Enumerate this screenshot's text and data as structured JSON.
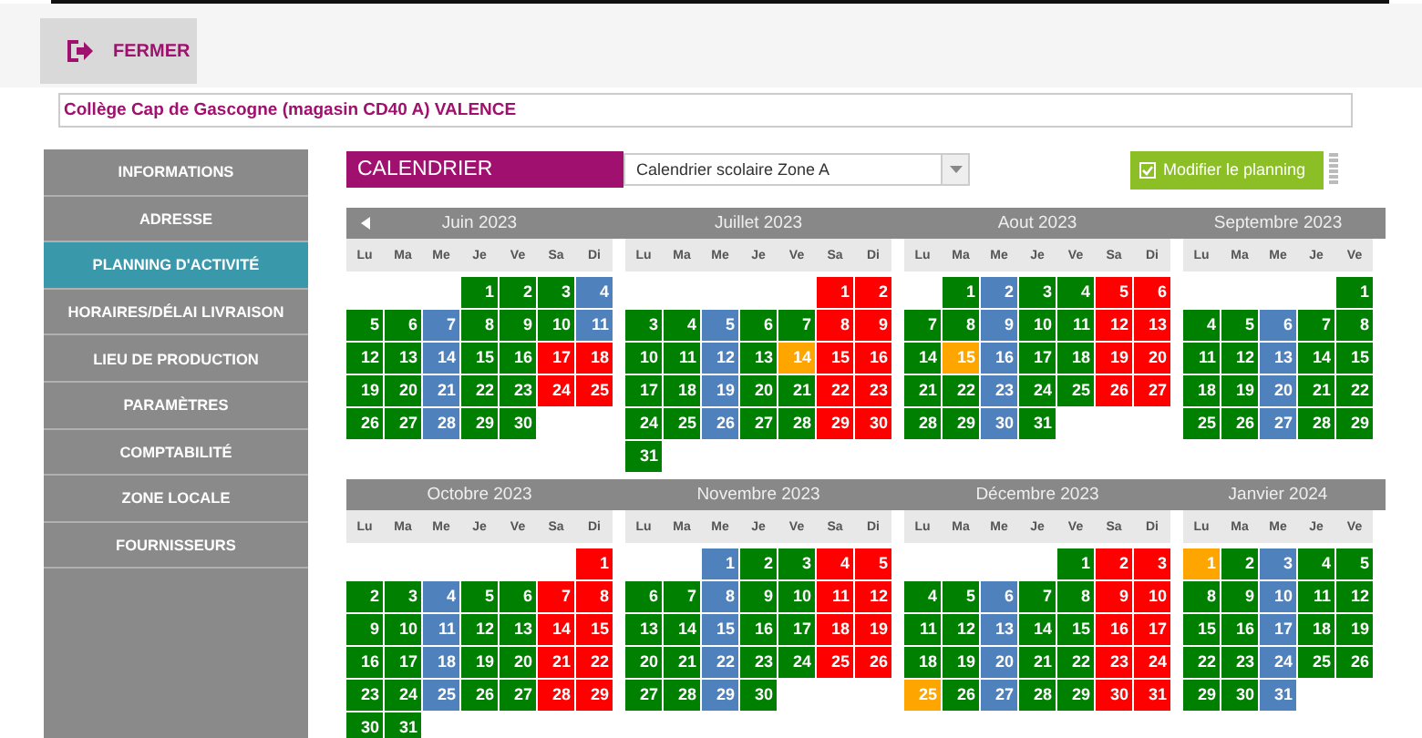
{
  "header": {
    "close_button": "FERMER"
  },
  "establishment": "Collège Cap de Gascogne (magasin CD40 A) VALENCE",
  "sidebar": {
    "items": [
      {
        "label": "INFORMATIONS",
        "selected": false
      },
      {
        "label": "ADRESSE",
        "selected": false
      },
      {
        "label": "PLANNING D'ACTIVITÉ",
        "selected": true
      },
      {
        "label": "HORAIRES/DÉLAI LIVRAISON",
        "selected": false
      },
      {
        "label": "LIEU DE PRODUCTION",
        "selected": false
      },
      {
        "label": "PARAMÈTRES",
        "selected": false
      },
      {
        "label": "COMPTABILITÉ",
        "selected": false
      },
      {
        "label": "ZONE LOCALE",
        "selected": false
      },
      {
        "label": "FOURNISSEURS",
        "selected": false
      }
    ]
  },
  "calendar": {
    "title": "CALENDRIER",
    "select_value": "Calendrier scolaire Zone A",
    "edit_button": "Modifier le planning",
    "rows": [
      {
        "months": [
          {
            "title": "Juin 2023",
            "weekdays": [
              "Lu",
              "Ma",
              "Me",
              "Je",
              "Ve",
              "Sa",
              "Di"
            ],
            "weeks": [
              [
                {
                  "day": "1",
                  "color": "#008000"
                },
                {
                  "day": "2",
                  "color": "#008000"
                },
                {
                  "day": "3",
                  "color": "#008000"
                },
                {
                  "day": "4",
                  "color": "#4f81bd"
                }
              ],
              [
                {
                  "day": "5",
                  "color": "#008000"
                },
                {
                  "day": "6",
                  "color": "#008000"
                },
                {
                  "day": "7",
                  "color": "#4f81bd"
                },
                {
                  "day": "8",
                  "color": "#008000"
                },
                {
                  "day": "9",
                  "color": "#008000"
                },
                {
                  "day": "10",
                  "color": "#008000"
                },
                {
                  "day": "11",
                  "color": "#4f81bd"
                }
              ],
              [
                {
                  "day": "12",
                  "color": "#008000"
                },
                {
                  "day": "13",
                  "color": "#008000"
                },
                {
                  "day": "14",
                  "color": "#4f81bd"
                },
                {
                  "day": "15",
                  "color": "#008000"
                },
                {
                  "day": "16",
                  "color": "#008000"
                },
                {
                  "day": "17",
                  "color": "#ff0000"
                },
                {
                  "day": "18",
                  "color": "#ff0000"
                }
              ],
              [
                {
                  "day": "19",
                  "color": "#008000"
                },
                {
                  "day": "20",
                  "color": "#008000"
                },
                {
                  "day": "21",
                  "color": "#4f81bd"
                },
                {
                  "day": "22",
                  "color": "#008000"
                },
                {
                  "day": "23",
                  "color": "#008000"
                },
                {
                  "day": "24",
                  "color": "#ff0000"
                },
                {
                  "day": "25",
                  "color": "#ff0000"
                }
              ],
              [
                {
                  "day": "26",
                  "color": "#008000"
                },
                {
                  "day": "27",
                  "color": "#008000"
                },
                {
                  "day": "28",
                  "color": "#4f81bd"
                },
                {
                  "day": "29",
                  "color": "#008000"
                },
                {
                  "day": "30",
                  "color": "#008000"
                }
              ]
            ]
          },
          {
            "title": "Juillet 2023",
            "weekdays": [
              "Lu",
              "Ma",
              "Me",
              "Je",
              "Ve",
              "Sa",
              "Di"
            ],
            "weeks": [
              [
                {
                  "day": "1",
                  "color": "#ff0000"
                },
                {
                  "day": "2",
                  "color": "#ff0000"
                }
              ],
              [
                {
                  "day": "3",
                  "color": "#008000"
                },
                {
                  "day": "4",
                  "color": "#008000"
                },
                {
                  "day": "5",
                  "color": "#4f81bd"
                },
                {
                  "day": "6",
                  "color": "#008000"
                },
                {
                  "day": "7",
                  "color": "#008000"
                },
                {
                  "day": "8",
                  "color": "#ff0000"
                },
                {
                  "day": "9",
                  "color": "#ff0000"
                }
              ],
              [
                {
                  "day": "10",
                  "color": "#008000"
                },
                {
                  "day": "11",
                  "color": "#008000"
                },
                {
                  "day": "12",
                  "color": "#4f81bd"
                },
                {
                  "day": "13",
                  "color": "#008000"
                },
                {
                  "day": "14",
                  "color": "#ffa500"
                },
                {
                  "day": "15",
                  "color": "#ff0000"
                },
                {
                  "day": "16",
                  "color": "#ff0000"
                }
              ],
              [
                {
                  "day": "17",
                  "color": "#008000"
                },
                {
                  "day": "18",
                  "color": "#008000"
                },
                {
                  "day": "19",
                  "color": "#4f81bd"
                },
                {
                  "day": "20",
                  "color": "#008000"
                },
                {
                  "day": "21",
                  "color": "#008000"
                },
                {
                  "day": "22",
                  "color": "#ff0000"
                },
                {
                  "day": "23",
                  "color": "#ff0000"
                }
              ],
              [
                {
                  "day": "24",
                  "color": "#008000"
                },
                {
                  "day": "25",
                  "color": "#008000"
                },
                {
                  "day": "26",
                  "color": "#4f81bd"
                },
                {
                  "day": "27",
                  "color": "#008000"
                },
                {
                  "day": "28",
                  "color": "#008000"
                },
                {
                  "day": "29",
                  "color": "#ff0000"
                },
                {
                  "day": "30",
                  "color": "#ff0000"
                }
              ],
              [
                {
                  "day": "31",
                  "color": "#008000"
                }
              ]
            ]
          },
          {
            "title": "Aout 2023",
            "weekdays": [
              "Lu",
              "Ma",
              "Me",
              "Je",
              "Ve",
              "Sa",
              "Di"
            ],
            "weeks": [
              [
                {
                  "day": "1",
                  "color": "#008000"
                },
                {
                  "day": "2",
                  "color": "#4f81bd"
                },
                {
                  "day": "3",
                  "color": "#008000"
                },
                {
                  "day": "4",
                  "color": "#008000"
                },
                {
                  "day": "5",
                  "color": "#ff0000"
                },
                {
                  "day": "6",
                  "color": "#ff0000"
                }
              ],
              [
                {
                  "day": "7",
                  "color": "#008000"
                },
                {
                  "day": "8",
                  "color": "#008000"
                },
                {
                  "day": "9",
                  "color": "#4f81bd"
                },
                {
                  "day": "10",
                  "color": "#008000"
                },
                {
                  "day": "11",
                  "color": "#008000"
                },
                {
                  "day": "12",
                  "color": "#ff0000"
                },
                {
                  "day": "13",
                  "color": "#ff0000"
                }
              ],
              [
                {
                  "day": "14",
                  "color": "#008000"
                },
                {
                  "day": "15",
                  "color": "#ffa500"
                },
                {
                  "day": "16",
                  "color": "#4f81bd"
                },
                {
                  "day": "17",
                  "color": "#008000"
                },
                {
                  "day": "18",
                  "color": "#008000"
                },
                {
                  "day": "19",
                  "color": "#ff0000"
                },
                {
                  "day": "20",
                  "color": "#ff0000"
                }
              ],
              [
                {
                  "day": "21",
                  "color": "#008000"
                },
                {
                  "day": "22",
                  "color": "#008000"
                },
                {
                  "day": "23",
                  "color": "#4f81bd"
                },
                {
                  "day": "24",
                  "color": "#008000"
                },
                {
                  "day": "25",
                  "color": "#008000"
                },
                {
                  "day": "26",
                  "color": "#ff0000"
                },
                {
                  "day": "27",
                  "color": "#ff0000"
                }
              ],
              [
                {
                  "day": "28",
                  "color": "#008000"
                },
                {
                  "day": "29",
                  "color": "#008000"
                },
                {
                  "day": "30",
                  "color": "#4f81bd"
                },
                {
                  "day": "31",
                  "color": "#008000"
                }
              ]
            ]
          },
          {
            "title": "Septembre 2023",
            "weekdays": [
              "Lu",
              "Ma",
              "Me",
              "Je",
              "Ve"
            ],
            "weeks": [
              [
                {
                  "day": "1",
                  "color": "#008000"
                }
              ],
              [
                {
                  "day": "4",
                  "color": "#008000"
                },
                {
                  "day": "5",
                  "color": "#008000"
                },
                {
                  "day": "6",
                  "color": "#4f81bd"
                },
                {
                  "day": "7",
                  "color": "#008000"
                },
                {
                  "day": "8",
                  "color": "#008000"
                }
              ],
              [
                {
                  "day": "11",
                  "color": "#008000"
                },
                {
                  "day": "12",
                  "color": "#008000"
                },
                {
                  "day": "13",
                  "color": "#4f81bd"
                },
                {
                  "day": "14",
                  "color": "#008000"
                },
                {
                  "day": "15",
                  "color": "#008000"
                }
              ],
              [
                {
                  "day": "18",
                  "color": "#008000"
                },
                {
                  "day": "19",
                  "color": "#008000"
                },
                {
                  "day": "20",
                  "color": "#4f81bd"
                },
                {
                  "day": "21",
                  "color": "#008000"
                },
                {
                  "day": "22",
                  "color": "#008000"
                }
              ],
              [
                {
                  "day": "25",
                  "color": "#008000"
                },
                {
                  "day": "26",
                  "color": "#008000"
                },
                {
                  "day": "27",
                  "color": "#4f81bd"
                },
                {
                  "day": "28",
                  "color": "#008000"
                },
                {
                  "day": "29",
                  "color": "#008000"
                }
              ]
            ]
          }
        ]
      },
      {
        "months": [
          {
            "title": "Octobre 2023",
            "weekdays": [
              "Lu",
              "Ma",
              "Me",
              "Je",
              "Ve",
              "Sa",
              "Di"
            ],
            "weeks": [
              [
                {
                  "day": "1",
                  "color": "#ff0000"
                }
              ],
              [
                {
                  "day": "2",
                  "color": "#008000"
                },
                {
                  "day": "3",
                  "color": "#008000"
                },
                {
                  "day": "4",
                  "color": "#4f81bd"
                },
                {
                  "day": "5",
                  "color": "#008000"
                },
                {
                  "day": "6",
                  "color": "#008000"
                },
                {
                  "day": "7",
                  "color": "#ff0000"
                },
                {
                  "day": "8",
                  "color": "#ff0000"
                }
              ],
              [
                {
                  "day": "9",
                  "color": "#008000"
                },
                {
                  "day": "10",
                  "color": "#008000"
                },
                {
                  "day": "11",
                  "color": "#4f81bd"
                },
                {
                  "day": "12",
                  "color": "#008000"
                },
                {
                  "day": "13",
                  "color": "#008000"
                },
                {
                  "day": "14",
                  "color": "#ff0000"
                },
                {
                  "day": "15",
                  "color": "#ff0000"
                }
              ],
              [
                {
                  "day": "16",
                  "color": "#008000"
                },
                {
                  "day": "17",
                  "color": "#008000"
                },
                {
                  "day": "18",
                  "color": "#4f81bd"
                },
                {
                  "day": "19",
                  "color": "#008000"
                },
                {
                  "day": "20",
                  "color": "#008000"
                },
                {
                  "day": "21",
                  "color": "#ff0000"
                },
                {
                  "day": "22",
                  "color": "#ff0000"
                }
              ],
              [
                {
                  "day": "23",
                  "color": "#008000"
                },
                {
                  "day": "24",
                  "color": "#008000"
                },
                {
                  "day": "25",
                  "color": "#4f81bd"
                },
                {
                  "day": "26",
                  "color": "#008000"
                },
                {
                  "day": "27",
                  "color": "#008000"
                },
                {
                  "day": "28",
                  "color": "#ff0000"
                },
                {
                  "day": "29",
                  "color": "#ff0000"
                }
              ],
              [
                {
                  "day": "30",
                  "color": "#008000"
                },
                {
                  "day": "31",
                  "color": "#008000"
                }
              ]
            ]
          },
          {
            "title": "Novembre 2023",
            "weekdays": [
              "Lu",
              "Ma",
              "Me",
              "Je",
              "Ve",
              "Sa",
              "Di"
            ],
            "weeks": [
              [
                {
                  "day": "1",
                  "color": "#4f81bd"
                },
                {
                  "day": "2",
                  "color": "#008000"
                },
                {
                  "day": "3",
                  "color": "#008000"
                },
                {
                  "day": "4",
                  "color": "#ff0000"
                },
                {
                  "day": "5",
                  "color": "#ff0000"
                }
              ],
              [
                {
                  "day": "6",
                  "color": "#008000"
                },
                {
                  "day": "7",
                  "color": "#008000"
                },
                {
                  "day": "8",
                  "color": "#4f81bd"
                },
                {
                  "day": "9",
                  "color": "#008000"
                },
                {
                  "day": "10",
                  "color": "#008000"
                },
                {
                  "day": "11",
                  "color": "#ff0000"
                },
                {
                  "day": "12",
                  "color": "#ff0000"
                }
              ],
              [
                {
                  "day": "13",
                  "color": "#008000"
                },
                {
                  "day": "14",
                  "color": "#008000"
                },
                {
                  "day": "15",
                  "color": "#4f81bd"
                },
                {
                  "day": "16",
                  "color": "#008000"
                },
                {
                  "day": "17",
                  "color": "#008000"
                },
                {
                  "day": "18",
                  "color": "#ff0000"
                },
                {
                  "day": "19",
                  "color": "#ff0000"
                }
              ],
              [
                {
                  "day": "20",
                  "color": "#008000"
                },
                {
                  "day": "21",
                  "color": "#008000"
                },
                {
                  "day": "22",
                  "color": "#4f81bd"
                },
                {
                  "day": "23",
                  "color": "#008000"
                },
                {
                  "day": "24",
                  "color": "#008000"
                },
                {
                  "day": "25",
                  "color": "#ff0000"
                },
                {
                  "day": "26",
                  "color": "#ff0000"
                }
              ],
              [
                {
                  "day": "27",
                  "color": "#008000"
                },
                {
                  "day": "28",
                  "color": "#008000"
                },
                {
                  "day": "29",
                  "color": "#4f81bd"
                },
                {
                  "day": "30",
                  "color": "#008000"
                }
              ]
            ]
          },
          {
            "title": "Décembre 2023",
            "weekdays": [
              "Lu",
              "Ma",
              "Me",
              "Je",
              "Ve",
              "Sa",
              "Di"
            ],
            "weeks": [
              [
                {
                  "day": "1",
                  "color": "#008000"
                },
                {
                  "day": "2",
                  "color": "#ff0000"
                },
                {
                  "day": "3",
                  "color": "#ff0000"
                }
              ],
              [
                {
                  "day": "4",
                  "color": "#008000"
                },
                {
                  "day": "5",
                  "color": "#008000"
                },
                {
                  "day": "6",
                  "color": "#4f81bd"
                },
                {
                  "day": "7",
                  "color": "#008000"
                },
                {
                  "day": "8",
                  "color": "#008000"
                },
                {
                  "day": "9",
                  "color": "#ff0000"
                },
                {
                  "day": "10",
                  "color": "#ff0000"
                }
              ],
              [
                {
                  "day": "11",
                  "color": "#008000"
                },
                {
                  "day": "12",
                  "color": "#008000"
                },
                {
                  "day": "13",
                  "color": "#4f81bd"
                },
                {
                  "day": "14",
                  "color": "#008000"
                },
                {
                  "day": "15",
                  "color": "#008000"
                },
                {
                  "day": "16",
                  "color": "#ff0000"
                },
                {
                  "day": "17",
                  "color": "#ff0000"
                }
              ],
              [
                {
                  "day": "18",
                  "color": "#008000"
                },
                {
                  "day": "19",
                  "color": "#008000"
                },
                {
                  "day": "20",
                  "color": "#4f81bd"
                },
                {
                  "day": "21",
                  "color": "#008000"
                },
                {
                  "day": "22",
                  "color": "#008000"
                },
                {
                  "day": "23",
                  "color": "#ff0000"
                },
                {
                  "day": "24",
                  "color": "#ff0000"
                }
              ],
              [
                {
                  "day": "25",
                  "color": "#ffa500"
                },
                {
                  "day": "26",
                  "color": "#008000"
                },
                {
                  "day": "27",
                  "color": "#4f81bd"
                },
                {
                  "day": "28",
                  "color": "#008000"
                },
                {
                  "day": "29",
                  "color": "#008000"
                },
                {
                  "day": "30",
                  "color": "#ff0000"
                },
                {
                  "day": "31",
                  "color": "#ff0000"
                }
              ]
            ]
          },
          {
            "title": "Janvier 2024",
            "weekdays": [
              "Lu",
              "Ma",
              "Me",
              "Je",
              "Ve"
            ],
            "weeks": [
              [
                {
                  "day": "1",
                  "color": "#ffa500"
                },
                {
                  "day": "2",
                  "color": "#008000"
                },
                {
                  "day": "3",
                  "color": "#4f81bd"
                },
                {
                  "day": "4",
                  "color": "#008000"
                },
                {
                  "day": "5",
                  "color": "#008000"
                }
              ],
              [
                {
                  "day": "8",
                  "color": "#008000"
                },
                {
                  "day": "9",
                  "color": "#008000"
                },
                {
                  "day": "10",
                  "color": "#4f81bd"
                },
                {
                  "day": "11",
                  "color": "#008000"
                },
                {
                  "day": "12",
                  "color": "#008000"
                }
              ],
              [
                {
                  "day": "15",
                  "color": "#008000"
                },
                {
                  "day": "16",
                  "color": "#008000"
                },
                {
                  "day": "17",
                  "color": "#4f81bd"
                },
                {
                  "day": "18",
                  "color": "#008000"
                },
                {
                  "day": "19",
                  "color": "#008000"
                }
              ],
              [
                {
                  "day": "22",
                  "color": "#008000"
                },
                {
                  "day": "23",
                  "color": "#008000"
                },
                {
                  "day": "24",
                  "color": "#4f81bd"
                },
                {
                  "day": "25",
                  "color": "#008000"
                },
                {
                  "day": "26",
                  "color": "#008000"
                }
              ],
              [
                {
                  "day": "29",
                  "color": "#008000"
                },
                {
                  "day": "30",
                  "color": "#008000"
                },
                {
                  "day": "31",
                  "color": "#4f81bd"
                }
              ]
            ]
          }
        ]
      }
    ]
  }
}
